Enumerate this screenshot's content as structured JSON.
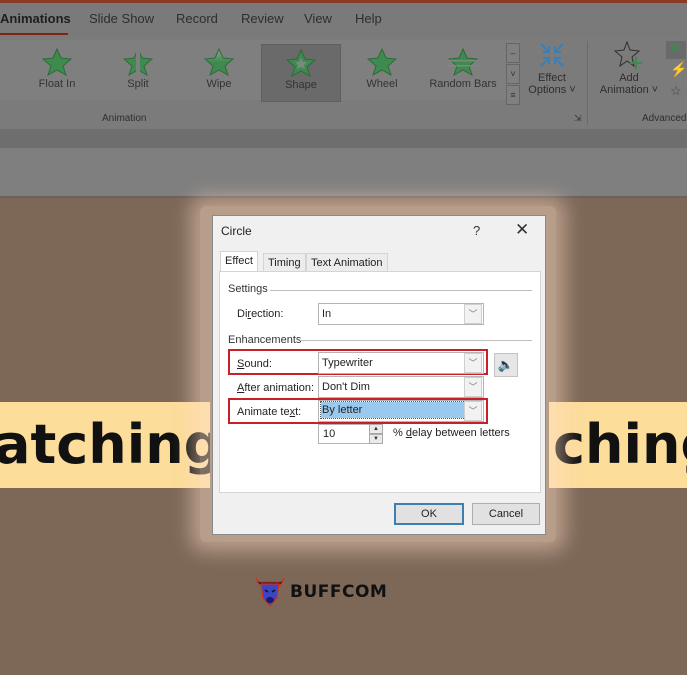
{
  "ribbon_tabs": [
    "Animations",
    "Slide Show",
    "Record",
    "Review",
    "View",
    "Help"
  ],
  "active_tab": "Animations",
  "animation_gallery": [
    {
      "label": "Float In",
      "selected": false
    },
    {
      "label": "Split",
      "selected": false
    },
    {
      "label": "Wipe",
      "selected": false
    },
    {
      "label": "Shape",
      "selected": true
    },
    {
      "label": "Wheel",
      "selected": false
    },
    {
      "label": "Random Bars",
      "selected": false
    }
  ],
  "effect_options": {
    "line1": "Effect",
    "line2": "Options ˅"
  },
  "add_animation": {
    "line1": "Add",
    "line2": "Animation ˅"
  },
  "group_labels": {
    "animation": "Animation",
    "advanced": "Advanced"
  },
  "slide_words": {
    "left": "atching",
    "right": "ching"
  },
  "colors": {
    "highlight_red": "#c8202a",
    "selection_blue": "#99c9ef",
    "slide_bg": "#7d6858",
    "word_bg": "#fcdd9a"
  },
  "dialog": {
    "title": "Circle",
    "help": "?",
    "close": "✕",
    "tabs": [
      "Effect",
      "Timing",
      "Text Animation"
    ],
    "active_tab": "Effect",
    "settings_label": "Settings",
    "direction": {
      "label_pre": "Di",
      "label_u": "r",
      "label_post": "ection:",
      "value": "In"
    },
    "enhancements_label": "Enhancements",
    "sound": {
      "label_u": "S",
      "label_post": "ound:",
      "value": "Typewriter"
    },
    "after_animation": {
      "label_u": "A",
      "label_post": "fter animation:",
      "value": "Don't Dim"
    },
    "animate_text": {
      "label_pre": "Animate te",
      "label_u": "x",
      "label_post": "t:",
      "value": "By letter"
    },
    "delay": {
      "value": "10",
      "suffix_pre": "% ",
      "suffix_u": "d",
      "suffix_post": "elay between letters"
    },
    "ok": "OK",
    "cancel": "Cancel"
  },
  "brand": {
    "name": "BUFFCOM"
  }
}
